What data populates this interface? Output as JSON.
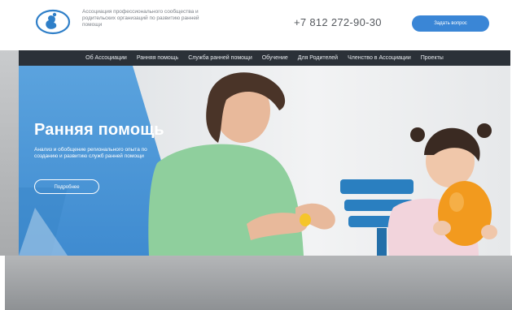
{
  "header": {
    "org_name": "Ассоциация профессионального сообщества и родительских организаций по развитию ранней помощи",
    "phone": "+7 812 272-90-30",
    "ask_button_label": "Задать вопрос"
  },
  "nav": {
    "items": [
      {
        "label": "Об Ассоциации"
      },
      {
        "label": "Ранняя помощь"
      },
      {
        "label": "Служба ранней помощи"
      },
      {
        "label": "Обучение"
      },
      {
        "label": "Для Родителей"
      },
      {
        "label": "Членство в Ассоциации"
      },
      {
        "label": "Проекты"
      }
    ]
  },
  "hero": {
    "title": "Ранняя помощь",
    "subtitle": "Анализ и обобщение регионального опыта по созданию и развитию служб ранней помощи",
    "more_button_label": "Подробнее"
  },
  "colors": {
    "accent": "#3a86d6",
    "nav_bg": "#2b3138",
    "hero_blue": "#4f9ad8",
    "logo_blue": "#2f7fc8"
  }
}
